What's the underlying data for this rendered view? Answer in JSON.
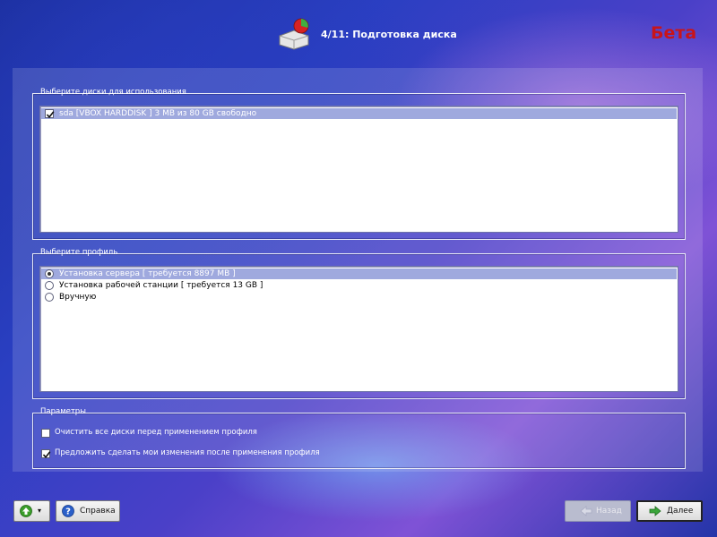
{
  "header": {
    "step_title": "4/11: Подготовка диска",
    "beta_label": "Бета",
    "icon": "disk-partition-icon"
  },
  "disks_group": {
    "legend": "Выберите диски для использования",
    "items": [
      {
        "label": "sda [VBOX HARDDISK   ]  3 MB из 80 GB свободно",
        "checked": true,
        "selected": true
      }
    ]
  },
  "profile_group": {
    "legend": "Выберите профиль",
    "items": [
      {
        "label": "Установка сервера [ требуется 8897 MB ]",
        "checked": true,
        "selected": true
      },
      {
        "label": "Установка рабочей станции [ требуется 13 GB ]",
        "checked": false,
        "selected": false
      },
      {
        "label": "Вручную",
        "checked": false,
        "selected": false
      }
    ]
  },
  "params_group": {
    "legend": "Параметры",
    "options": [
      {
        "label": "Очистить все диски перед применением профиля",
        "checked": false
      },
      {
        "label": "Предложить сделать мои изменения после применения профиля",
        "checked": true
      }
    ]
  },
  "footer": {
    "menu_icon": "green-arrow-up-icon",
    "help_label": "Справка",
    "back_label": "Назад",
    "next_label": "Далее"
  },
  "colors": {
    "beta": "#c8141a",
    "selection": "#9fa9de",
    "next_arrow": "#2c9a2c"
  }
}
